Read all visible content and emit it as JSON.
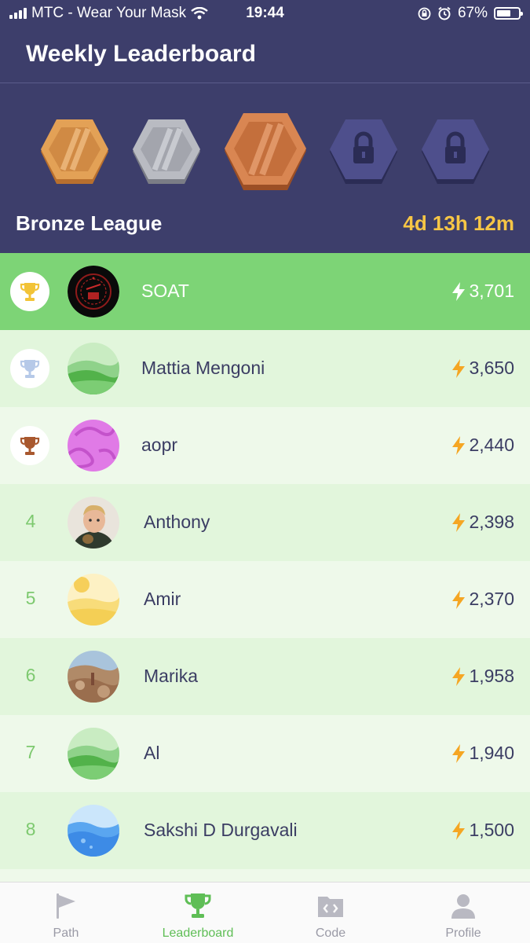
{
  "status_bar": {
    "carrier": "MTC - Wear Your Mask",
    "time": "19:44",
    "battery": "67%",
    "battery_level": 0.67
  },
  "header": {
    "title": "Weekly Leaderboard"
  },
  "league": {
    "badges": [
      {
        "name": "gold-badge",
        "state": "unlocked",
        "color": "#d9924a"
      },
      {
        "name": "silver-badge",
        "state": "unlocked",
        "color": "#9ea0a8"
      },
      {
        "name": "bronze-badge",
        "state": "current",
        "color": "#c76e3c"
      },
      {
        "name": "locked-badge",
        "state": "locked",
        "color": "#4e4f8c"
      },
      {
        "name": "locked-badge",
        "state": "locked",
        "color": "#4e4f8c"
      }
    ],
    "name": "Bronze League",
    "time_left": "4d 13h 12m"
  },
  "rows": [
    {
      "rank": "1",
      "trophy": "gold",
      "name": "SOAT",
      "score": "3,701",
      "avatar": "dark-logo"
    },
    {
      "rank": "2",
      "trophy": "silver",
      "name": "Mattia Mengoni",
      "score": "3,650",
      "avatar": "green-hills"
    },
    {
      "rank": "3",
      "trophy": "bronze",
      "name": "aopr",
      "score": "2,440",
      "avatar": "pink-squiggle"
    },
    {
      "rank": "4",
      "name": "Anthony",
      "score": "2,398",
      "avatar": "photo"
    },
    {
      "rank": "5",
      "name": "Amir",
      "score": "2,370",
      "avatar": "yellow-desert"
    },
    {
      "rank": "6",
      "name": "Marika",
      "score": "1,958",
      "avatar": "photo-rocks"
    },
    {
      "rank": "7",
      "name": "Al",
      "score": "1,940",
      "avatar": "green-hills"
    },
    {
      "rank": "8",
      "name": "Sakshi D Durgavali",
      "score": "1,500",
      "avatar": "blue-water"
    }
  ],
  "tabs": [
    {
      "label": "Path",
      "icon": "flag-icon"
    },
    {
      "label": "Leaderboard",
      "icon": "trophy-icon",
      "active": true
    },
    {
      "label": "Code",
      "icon": "code-folder-icon"
    },
    {
      "label": "Profile",
      "icon": "person-icon"
    }
  ],
  "colors": {
    "header_bg": "#3d3e6b",
    "accent_green": "#7dd476",
    "timer_yellow": "#f7c645",
    "bolt_orange": "#f5a623"
  }
}
